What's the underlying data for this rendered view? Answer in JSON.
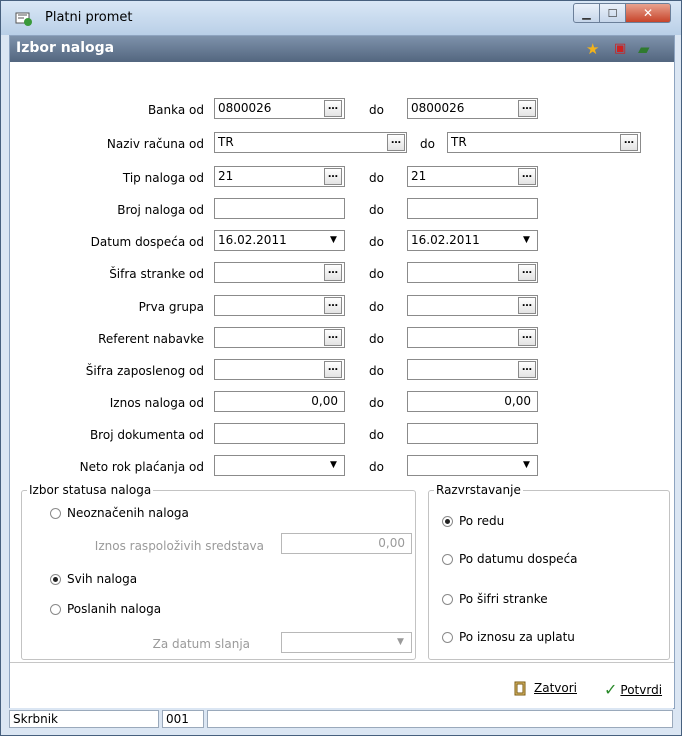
{
  "window": {
    "title": "Platni promet"
  },
  "header": {
    "title": "Izbor naloga"
  },
  "fields": {
    "banka": {
      "label": "Banka od",
      "from": "0800026",
      "to": "0800026"
    },
    "naziv": {
      "label": "Naziv računa od",
      "from": "TR",
      "to": "TR"
    },
    "tip": {
      "label": "Tip naloga od",
      "from": "21",
      "to": "21"
    },
    "broj": {
      "label": "Broj naloga od",
      "from": "",
      "to": ""
    },
    "datum": {
      "label": "Datum dospeća od",
      "from": "16.02.2011",
      "to": "16.02.2011"
    },
    "sifra_stranke": {
      "label": "Šifra stranke od",
      "from": "",
      "to": ""
    },
    "prva_grupa": {
      "label": "Prva grupa",
      "from": "",
      "to": ""
    },
    "referent": {
      "label": "Referent nabavke",
      "from": "",
      "to": ""
    },
    "sifra_zaposlenog": {
      "label": "Šifra zaposlenog od",
      "from": "",
      "to": ""
    },
    "iznos": {
      "label": "Iznos naloga od",
      "from": "0,00",
      "to": "0,00"
    },
    "broj_dokumenta": {
      "label": "Broj dokumenta od",
      "from": "",
      "to": ""
    },
    "neto_rok": {
      "label": "Neto rok plaćanja od",
      "from": "",
      "to": ""
    },
    "do_label": "do"
  },
  "status_group": {
    "legend": "Izbor statusa naloga",
    "opt1": "Neoznačenih naloga",
    "iznos_label": "Iznos raspoloživih sredstava",
    "iznos_value": "0,00",
    "opt2": "Svih naloga",
    "opt3": "Poslanih naloga",
    "za_datum_label": "Za datum slanja",
    "za_datum_value": ""
  },
  "sort_group": {
    "legend": "Razvrstavanje",
    "opt1": "Po redu",
    "opt2": "Po datumu dospeća",
    "opt3": "Po šifri stranke",
    "opt4": "Po iznosu za uplatu"
  },
  "buttons": {
    "close": "Zatvori",
    "confirm": "Potvrdi"
  },
  "status_bar": {
    "user": "Skrbnik",
    "code": "001"
  },
  "colors": {
    "header": "#5d708a",
    "accent": "#2a8a2a"
  }
}
